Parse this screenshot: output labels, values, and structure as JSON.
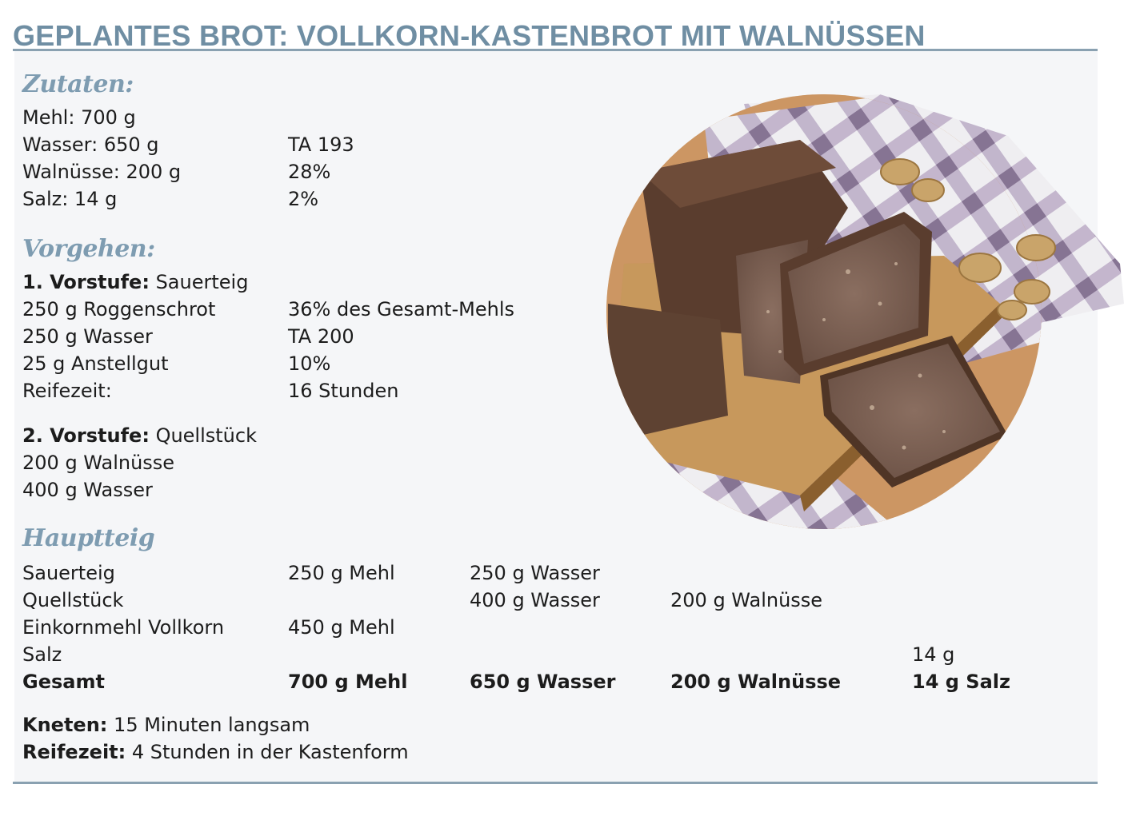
{
  "title": "GEPLANTES BROT: VOLLKORN-KASTENBROT MIT WALNÜSSEN",
  "zutaten": {
    "heading": "Zutaten:",
    "rows": [
      {
        "label": "Mehl: 700 g",
        "value": ""
      },
      {
        "label": "Wasser: 650 g",
        "value": "TA 193"
      },
      {
        "label": "Walnüsse: 200 g",
        "value": "28%"
      },
      {
        "label": "Salz: 14 g",
        "value": "2%"
      }
    ]
  },
  "vorgehen": {
    "heading": "Vorgehen:",
    "stufe1": {
      "label": "1. Vorstufe:",
      "name": "Sauerteig",
      "rows": [
        {
          "label": "250 g Roggenschrot",
          "value": "36% des Gesamt-Mehls"
        },
        {
          "label": "250 g Wasser",
          "value": "TA 200"
        },
        {
          "label": "25 g Anstellgut",
          "value": "10%"
        },
        {
          "label": "Reifezeit:",
          "value": "16 Stunden"
        }
      ]
    },
    "stufe2": {
      "label": "2. Vorstufe:",
      "name": "Quellstück",
      "rows": [
        "200 g Walnüsse",
        "400 g Wasser"
      ]
    }
  },
  "hauptteig": {
    "heading": "Hauptteig",
    "rows": [
      [
        "Sauerteig",
        "250 g Mehl",
        "250 g Wasser",
        "",
        ""
      ],
      [
        "Quellstück",
        "",
        "400 g Wasser",
        "200 g Walnüsse",
        ""
      ],
      [
        "Einkornmehl Vollkorn",
        "450 g Mehl",
        "",
        "",
        ""
      ],
      [
        "Salz",
        "",
        "",
        "",
        "14 g"
      ]
    ],
    "total": [
      "Gesamt",
      "700 g Mehl",
      "650 g Wasser",
      "200 g Walnüsse",
      "14 g Salz"
    ]
  },
  "kneten": {
    "label": "Kneten:",
    "value": "15 Minuten langsam"
  },
  "reifezeit": {
    "label": "Reifezeit:",
    "value": "4 Stunden in der Kastenform"
  },
  "colors": {
    "title": "#6f8ea3",
    "heading": "#7e9cb1",
    "panel": "#f5f6f8"
  }
}
